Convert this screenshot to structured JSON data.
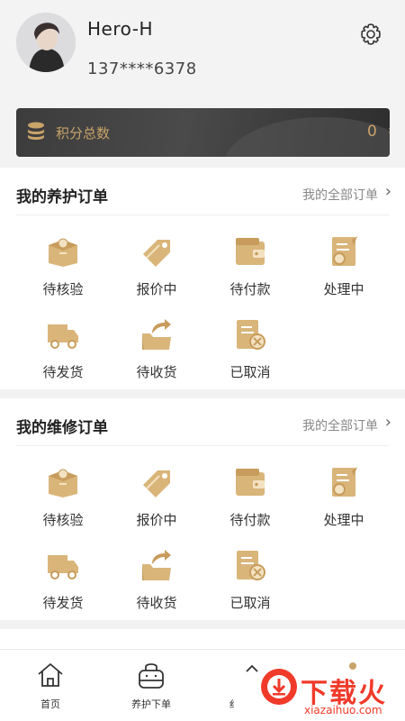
{
  "profile": {
    "username": "Hero-H",
    "phone": "137****6378"
  },
  "points": {
    "label": "积分总数",
    "value": "0"
  },
  "maintenance_orders": {
    "title": "我的养护订单",
    "all_link": "我的全部订单",
    "items": [
      {
        "label": "待核验",
        "icon": "box-verify-icon"
      },
      {
        "label": "报价中",
        "icon": "price-tag-icon"
      },
      {
        "label": "待付款",
        "icon": "wallet-icon"
      },
      {
        "label": "处理中",
        "icon": "processing-doc-icon"
      },
      {
        "label": "待发货",
        "icon": "truck-icon"
      },
      {
        "label": "待收货",
        "icon": "receive-folder-icon"
      },
      {
        "label": "已取消",
        "icon": "cancelled-doc-icon"
      }
    ]
  },
  "repair_orders": {
    "title": "我的维修订单",
    "all_link": "我的全部订单",
    "items": [
      {
        "label": "待核验",
        "icon": "box-verify-icon"
      },
      {
        "label": "报价中",
        "icon": "price-tag-icon"
      },
      {
        "label": "待付款",
        "icon": "wallet-icon"
      },
      {
        "label": "处理中",
        "icon": "processing-doc-icon"
      },
      {
        "label": "待发货",
        "icon": "truck-icon"
      },
      {
        "label": "待收货",
        "icon": "receive-folder-icon"
      },
      {
        "label": "已取消",
        "icon": "cancelled-doc-icon"
      }
    ]
  },
  "tabbar": {
    "items": [
      {
        "label": "首页",
        "icon": "home-icon"
      },
      {
        "label": "养护下单",
        "icon": "bag-icon"
      },
      {
        "label": "纟",
        "icon": "tab3-icon"
      },
      {
        "label": "",
        "icon": "tab4-icon"
      }
    ]
  },
  "watermark": {
    "text": "下载火",
    "url": "xiazaihuo.com"
  },
  "colors": {
    "accent_gold": "#c9a36a",
    "card_dark": "#3c3c3c",
    "watermark_red": "#f03a2a"
  }
}
